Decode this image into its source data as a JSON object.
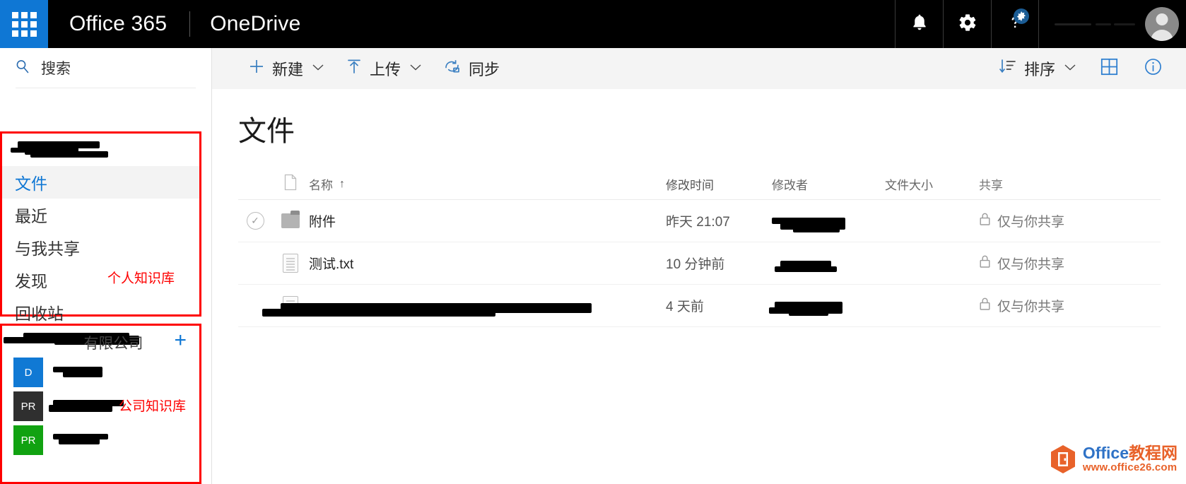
{
  "suite": {
    "app_launcher": "app-launcher",
    "brand": "Office 365",
    "app_name": "OneDrive",
    "icons": [
      "notifications-bell",
      "settings-gear",
      "help-question"
    ],
    "user_name_redacted": "",
    "avatar": "user-avatar"
  },
  "sidebar": {
    "search_placeholder": "搜索",
    "personal": {
      "owner_name_redacted": "",
      "items": [
        {
          "label": "文件",
          "active": true
        },
        {
          "label": "最近",
          "active": false
        },
        {
          "label": "与我共享",
          "active": false
        },
        {
          "label": "发现",
          "active": false
        },
        {
          "label": "回收站",
          "active": false
        }
      ],
      "annotation": "个人知识库"
    },
    "company": {
      "name_suffix": "有限公司",
      "add_label": "+",
      "annotation": "公司知识库",
      "sites": [
        {
          "tile": "D",
          "tile_color": "#1079d4",
          "name_redacted": ""
        },
        {
          "tile": "PR",
          "tile_color": "#2f2f2f",
          "name_redacted": ""
        },
        {
          "tile": "PR",
          "tile_color": "#11a211",
          "name_redacted": ""
        }
      ]
    }
  },
  "commandbar": {
    "new": "新建",
    "upload": "上传",
    "sync": "同步",
    "sort": "排序",
    "chevron": "⌄",
    "view_tiles": "grid-view",
    "info": "information"
  },
  "main": {
    "title": "文件",
    "columns": {
      "name": "名称",
      "sort_arrow": "↑",
      "modified": "修改时间",
      "modified_by": "修改者",
      "size": "文件大小",
      "sharing": "共享"
    },
    "rows": [
      {
        "icon": "folder",
        "name": "附件",
        "name_redacted": false,
        "selected_check": true,
        "modified": "昨天 21:07",
        "modified_by_redacted": "",
        "size": "",
        "sharing": "仅与你共享"
      },
      {
        "icon": "text-document",
        "name": "测试.txt",
        "name_redacted": false,
        "selected_check": false,
        "modified": "10 分钟前",
        "modified_by_redacted": "",
        "size": "",
        "sharing": "仅与你共享"
      },
      {
        "icon": "text-document",
        "name": "",
        "name_redacted": true,
        "selected_check": false,
        "modified": "4 天前",
        "modified_by_redacted": "",
        "size": "",
        "sharing": "仅与你共享"
      }
    ]
  },
  "watermark": {
    "title_en": "Office",
    "title_cn": "教程网",
    "url": "www.office26.com"
  },
  "colors": {
    "suite_bar": "#000000",
    "waffle_blue": "#0f77d4",
    "accent": "#0f77d4",
    "annotation_red": "#fe0000",
    "command_bar": "#f4f4f4"
  }
}
